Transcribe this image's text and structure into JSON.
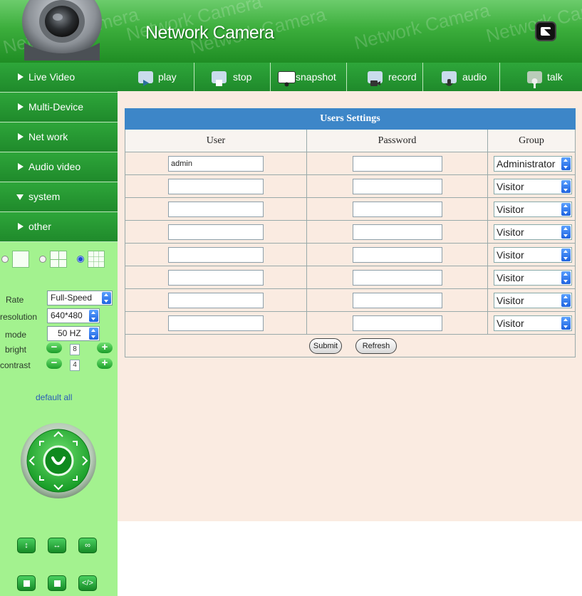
{
  "header": {
    "title": "Network Camera",
    "watermark": "Network Camera",
    "fullscreen_icon": "fullscreen-icon"
  },
  "sidebar": {
    "nav": [
      {
        "label": "Live Video",
        "expanded": false
      },
      {
        "label": "Multi-Device",
        "expanded": false
      },
      {
        "label": "Net work",
        "expanded": false
      },
      {
        "label": "Audio video",
        "expanded": false
      },
      {
        "label": "system",
        "expanded": true
      },
      {
        "label": "other",
        "expanded": false
      }
    ],
    "layout_selected": "layout-9",
    "controls": {
      "rate_label": "Rate",
      "rate_value": "Full-Speed",
      "resolution_label": "resolution",
      "resolution_value": "640*480",
      "mode_label": "mode",
      "mode_value": "50 HZ",
      "bright_label": "bright",
      "bright_value": "8",
      "contrast_label": "contrast",
      "contrast_value": "4",
      "default_all": "default all"
    }
  },
  "toolbar": [
    {
      "label": "play",
      "icon": "play-icon"
    },
    {
      "label": "stop",
      "icon": "stop-icon"
    },
    {
      "label": "snapshot",
      "icon": "snapshot-icon"
    },
    {
      "label": "record",
      "icon": "record-icon"
    },
    {
      "label": "audio",
      "icon": "audio-icon"
    },
    {
      "label": "talk",
      "icon": "talk-icon"
    }
  ],
  "users_settings": {
    "title": "Users Settings",
    "columns": [
      "User",
      "Password",
      "Group"
    ],
    "rows": [
      {
        "user": "admin",
        "password": "",
        "group": "Administrator"
      },
      {
        "user": "",
        "password": "",
        "group": "Visitor"
      },
      {
        "user": "",
        "password": "",
        "group": "Visitor"
      },
      {
        "user": "",
        "password": "",
        "group": "Visitor"
      },
      {
        "user": "",
        "password": "",
        "group": "Visitor"
      },
      {
        "user": "",
        "password": "",
        "group": "Visitor"
      },
      {
        "user": "",
        "password": "",
        "group": "Visitor"
      },
      {
        "user": "",
        "password": "",
        "group": "Visitor"
      }
    ],
    "submit_label": "Submit",
    "refresh_label": "Refresh"
  },
  "colors": {
    "brand_green": "#2ea63a",
    "sidebar_bg": "#a3f28f",
    "table_header_blue": "#3d86c8",
    "panel_bg": "#faebe1"
  }
}
